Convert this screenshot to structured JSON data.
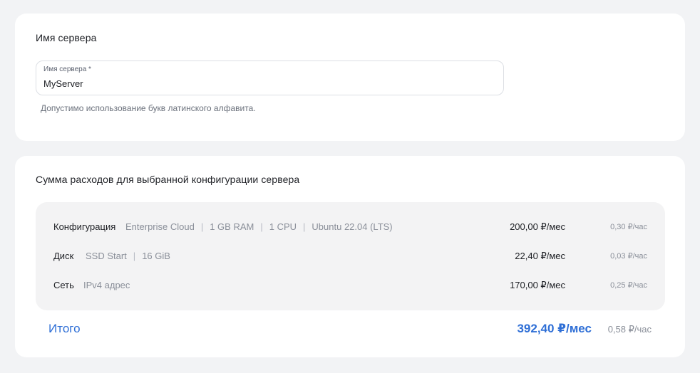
{
  "server_name_section": {
    "title": "Имя сервера",
    "field_label": "Имя сервера *",
    "field_value": "MyServer",
    "hint": "Допустимо использование букв латинского алфавита."
  },
  "cost_section": {
    "title": "Сумма расходов для выбранной конфигурации сервера",
    "rows": [
      {
        "label": "Конфигурация",
        "specs": [
          "Enterprise Cloud",
          "1 GB RAM",
          "1 CPU",
          "Ubuntu 22.04 (LTS)"
        ],
        "month": "200,00 ₽/мес",
        "hour": "0,30 ₽/час"
      },
      {
        "label": "Диск",
        "specs": [
          "SSD Start",
          "16 GiB"
        ],
        "month": "22,40 ₽/мес",
        "hour": "0,03 ₽/час"
      },
      {
        "label": "Сеть",
        "specs": [
          "IPv4 адрес"
        ],
        "month": "170,00 ₽/мес",
        "hour": "0,25 ₽/час"
      }
    ],
    "separator": "|",
    "total": {
      "label": "Итого",
      "month": "392,40 ₽/мес",
      "hour": "0,58 ₽/час"
    }
  },
  "colors": {
    "page_background": "#f2f3f5",
    "card_background": "#ffffff",
    "config_box_background": "#f3f3f4",
    "accent_blue": "#2f6fd6",
    "muted_text": "#8a8f99"
  }
}
